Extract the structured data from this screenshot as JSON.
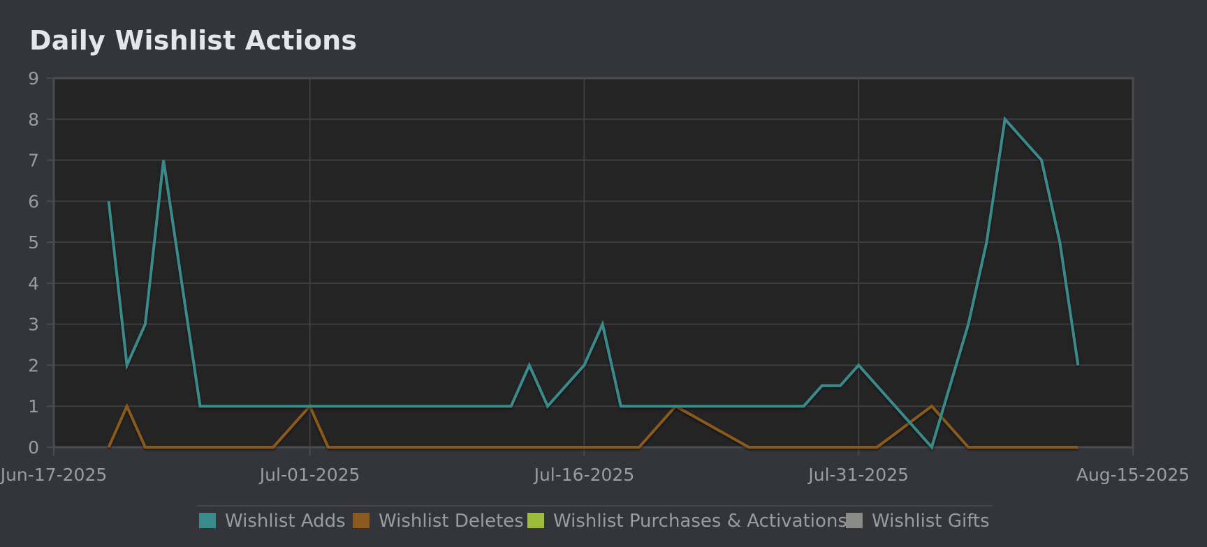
{
  "chart_data": {
    "type": "line",
    "title": "Daily Wishlist Actions",
    "xlabel": "",
    "ylabel": "",
    "ylim": [
      0,
      9
    ],
    "yticks": [
      0,
      1,
      2,
      3,
      4,
      5,
      6,
      7,
      8,
      9
    ],
    "xlim": [
      "2025-06-17",
      "2025-08-15"
    ],
    "xticks": [
      {
        "date": "2025-06-17",
        "label": "Jun-17-2025"
      },
      {
        "date": "2025-07-01",
        "label": "Jul-01-2025"
      },
      {
        "date": "2025-07-16",
        "label": "Jul-16-2025"
      },
      {
        "date": "2025-07-31",
        "label": "Jul-31-2025"
      },
      {
        "date": "2025-08-15",
        "label": "Aug-15-2025"
      }
    ],
    "grid": true,
    "legend_position": "bottom",
    "series": [
      {
        "name": "Wishlist Adds",
        "color": "#3b8a8b",
        "points": [
          [
            "2025-06-20",
            6
          ],
          [
            "2025-06-21",
            2
          ],
          [
            "2025-06-22",
            3
          ],
          [
            "2025-06-23",
            7
          ],
          [
            "2025-06-25",
            1
          ],
          [
            "2025-06-26",
            1
          ],
          [
            "2025-06-27",
            1
          ],
          [
            "2025-06-28",
            1
          ],
          [
            "2025-06-29",
            1
          ],
          [
            "2025-06-30",
            1
          ],
          [
            "2025-07-01",
            1
          ],
          [
            "2025-07-02",
            1
          ],
          [
            "2025-07-03",
            1
          ],
          [
            "2025-07-04",
            1
          ],
          [
            "2025-07-05",
            1
          ],
          [
            "2025-07-06",
            1
          ],
          [
            "2025-07-07",
            1
          ],
          [
            "2025-07-08",
            1
          ],
          [
            "2025-07-09",
            1
          ],
          [
            "2025-07-10",
            1
          ],
          [
            "2025-07-11",
            1
          ],
          [
            "2025-07-12",
            1
          ],
          [
            "2025-07-13",
            2
          ],
          [
            "2025-07-14",
            1
          ],
          [
            "2025-07-15",
            1.5
          ],
          [
            "2025-07-16",
            2
          ],
          [
            "2025-07-17",
            3
          ],
          [
            "2025-07-18",
            1
          ],
          [
            "2025-07-19",
            1
          ],
          [
            "2025-07-20",
            1
          ],
          [
            "2025-07-21",
            1
          ],
          [
            "2025-07-22",
            1
          ],
          [
            "2025-07-23",
            1
          ],
          [
            "2025-07-24",
            1
          ],
          [
            "2025-07-25",
            1
          ],
          [
            "2025-07-26",
            1
          ],
          [
            "2025-07-27",
            1
          ],
          [
            "2025-07-28",
            1
          ],
          [
            "2025-07-29",
            1.5
          ],
          [
            "2025-07-30",
            1.5
          ],
          [
            "2025-07-31",
            2
          ],
          [
            "2025-08-01",
            1.5
          ],
          [
            "2025-08-02",
            1
          ],
          [
            "2025-08-03",
            0.5
          ],
          [
            "2025-08-04",
            0
          ],
          [
            "2025-08-05",
            1.5
          ],
          [
            "2025-08-06",
            3
          ],
          [
            "2025-08-07",
            5
          ],
          [
            "2025-08-08",
            8
          ],
          [
            "2025-08-09",
            7.5
          ],
          [
            "2025-08-10",
            7
          ],
          [
            "2025-08-11",
            5
          ],
          [
            "2025-08-12",
            2
          ]
        ]
      },
      {
        "name": "Wishlist Deletes",
        "color": "#8a5a1e",
        "points": [
          [
            "2025-06-20",
            0
          ],
          [
            "2025-06-21",
            1
          ],
          [
            "2025-06-22",
            0
          ],
          [
            "2025-06-23",
            0
          ],
          [
            "2025-06-24",
            0
          ],
          [
            "2025-06-25",
            0
          ],
          [
            "2025-06-26",
            0
          ],
          [
            "2025-06-27",
            0
          ],
          [
            "2025-06-28",
            0
          ],
          [
            "2025-06-29",
            0
          ],
          [
            "2025-06-30",
            0.5
          ],
          [
            "2025-07-01",
            1
          ],
          [
            "2025-07-02",
            0
          ],
          [
            "2025-07-03",
            0
          ],
          [
            "2025-07-04",
            0
          ],
          [
            "2025-07-05",
            0
          ],
          [
            "2025-07-06",
            0
          ],
          [
            "2025-07-07",
            0
          ],
          [
            "2025-07-08",
            0
          ],
          [
            "2025-07-09",
            0
          ],
          [
            "2025-07-10",
            0
          ],
          [
            "2025-07-11",
            0
          ],
          [
            "2025-07-12",
            0
          ],
          [
            "2025-07-13",
            0
          ],
          [
            "2025-07-14",
            0
          ],
          [
            "2025-07-15",
            0
          ],
          [
            "2025-07-16",
            0
          ],
          [
            "2025-07-17",
            0
          ],
          [
            "2025-07-18",
            0
          ],
          [
            "2025-07-19",
            0
          ],
          [
            "2025-07-20",
            0.5
          ],
          [
            "2025-07-21",
            1
          ],
          [
            "2025-07-22",
            0.75
          ],
          [
            "2025-07-23",
            0.5
          ],
          [
            "2025-07-24",
            0.25
          ],
          [
            "2025-07-25",
            0
          ],
          [
            "2025-07-26",
            0
          ],
          [
            "2025-07-27",
            0
          ],
          [
            "2025-07-28",
            0
          ],
          [
            "2025-07-29",
            0
          ],
          [
            "2025-07-30",
            0
          ],
          [
            "2025-07-31",
            0
          ],
          [
            "2025-08-01",
            0
          ],
          [
            "2025-08-02",
            0.33
          ],
          [
            "2025-08-03",
            0.67
          ],
          [
            "2025-08-04",
            1
          ],
          [
            "2025-08-05",
            0.5
          ],
          [
            "2025-08-06",
            0
          ],
          [
            "2025-08-07",
            0
          ],
          [
            "2025-08-08",
            0
          ],
          [
            "2025-08-09",
            0
          ],
          [
            "2025-08-10",
            0
          ],
          [
            "2025-08-11",
            0
          ],
          [
            "2025-08-12",
            0
          ]
        ]
      },
      {
        "name": "Wishlist Purchases & Activations",
        "color": "#9cbc3a",
        "points": [
          [
            "2025-06-20",
            0
          ],
          [
            "2025-08-12",
            0
          ]
        ]
      },
      {
        "name": "Wishlist Gifts",
        "color": "#8a8a88",
        "points": [
          [
            "2025-06-20",
            0
          ],
          [
            "2025-08-12",
            0
          ]
        ]
      }
    ]
  }
}
